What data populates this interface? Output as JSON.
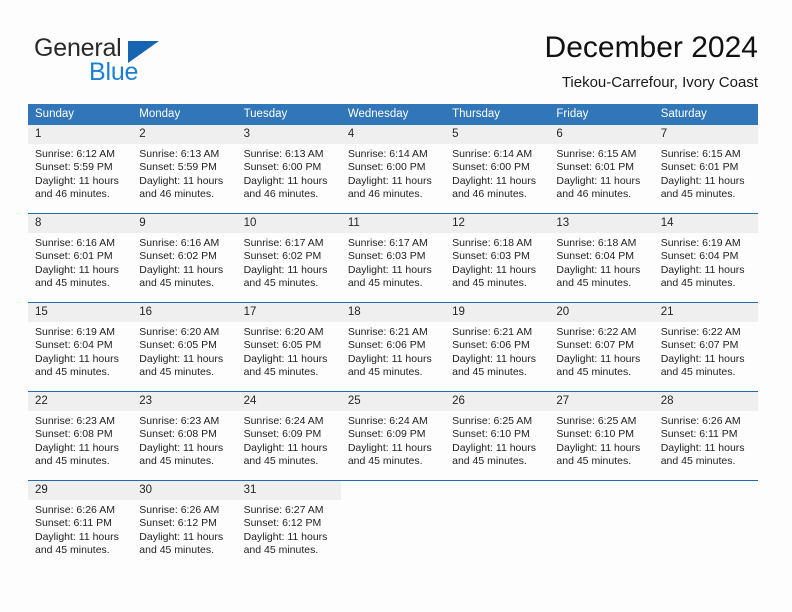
{
  "brand": {
    "name_line1": "General",
    "name_line2": "Blue",
    "triangle_color": "#1565b0",
    "blue_text_color": "#1b7fd4"
  },
  "header": {
    "title": "December 2024",
    "subtitle": "Tiekou-Carrefour, Ivory Coast"
  },
  "theme": {
    "header_bg": "#3176b9",
    "header_text": "#ffffff",
    "daynum_bg": "#efefef",
    "row_separator": "#1f6cb0",
    "page_bg": "#fdfdfd"
  },
  "weekdays": [
    "Sunday",
    "Monday",
    "Tuesday",
    "Wednesday",
    "Thursday",
    "Friday",
    "Saturday"
  ],
  "weeks": [
    [
      {
        "day": "1",
        "sunrise": "Sunrise: 6:12 AM",
        "sunset": "Sunset: 5:59 PM",
        "daylight1": "Daylight: 11 hours",
        "daylight2": "and 46 minutes."
      },
      {
        "day": "2",
        "sunrise": "Sunrise: 6:13 AM",
        "sunset": "Sunset: 5:59 PM",
        "daylight1": "Daylight: 11 hours",
        "daylight2": "and 46 minutes."
      },
      {
        "day": "3",
        "sunrise": "Sunrise: 6:13 AM",
        "sunset": "Sunset: 6:00 PM",
        "daylight1": "Daylight: 11 hours",
        "daylight2": "and 46 minutes."
      },
      {
        "day": "4",
        "sunrise": "Sunrise: 6:14 AM",
        "sunset": "Sunset: 6:00 PM",
        "daylight1": "Daylight: 11 hours",
        "daylight2": "and 46 minutes."
      },
      {
        "day": "5",
        "sunrise": "Sunrise: 6:14 AM",
        "sunset": "Sunset: 6:00 PM",
        "daylight1": "Daylight: 11 hours",
        "daylight2": "and 46 minutes."
      },
      {
        "day": "6",
        "sunrise": "Sunrise: 6:15 AM",
        "sunset": "Sunset: 6:01 PM",
        "daylight1": "Daylight: 11 hours",
        "daylight2": "and 46 minutes."
      },
      {
        "day": "7",
        "sunrise": "Sunrise: 6:15 AM",
        "sunset": "Sunset: 6:01 PM",
        "daylight1": "Daylight: 11 hours",
        "daylight2": "and 45 minutes."
      }
    ],
    [
      {
        "day": "8",
        "sunrise": "Sunrise: 6:16 AM",
        "sunset": "Sunset: 6:01 PM",
        "daylight1": "Daylight: 11 hours",
        "daylight2": "and 45 minutes."
      },
      {
        "day": "9",
        "sunrise": "Sunrise: 6:16 AM",
        "sunset": "Sunset: 6:02 PM",
        "daylight1": "Daylight: 11 hours",
        "daylight2": "and 45 minutes."
      },
      {
        "day": "10",
        "sunrise": "Sunrise: 6:17 AM",
        "sunset": "Sunset: 6:02 PM",
        "daylight1": "Daylight: 11 hours",
        "daylight2": "and 45 minutes."
      },
      {
        "day": "11",
        "sunrise": "Sunrise: 6:17 AM",
        "sunset": "Sunset: 6:03 PM",
        "daylight1": "Daylight: 11 hours",
        "daylight2": "and 45 minutes."
      },
      {
        "day": "12",
        "sunrise": "Sunrise: 6:18 AM",
        "sunset": "Sunset: 6:03 PM",
        "daylight1": "Daylight: 11 hours",
        "daylight2": "and 45 minutes."
      },
      {
        "day": "13",
        "sunrise": "Sunrise: 6:18 AM",
        "sunset": "Sunset: 6:04 PM",
        "daylight1": "Daylight: 11 hours",
        "daylight2": "and 45 minutes."
      },
      {
        "day": "14",
        "sunrise": "Sunrise: 6:19 AM",
        "sunset": "Sunset: 6:04 PM",
        "daylight1": "Daylight: 11 hours",
        "daylight2": "and 45 minutes."
      }
    ],
    [
      {
        "day": "15",
        "sunrise": "Sunrise: 6:19 AM",
        "sunset": "Sunset: 6:04 PM",
        "daylight1": "Daylight: 11 hours",
        "daylight2": "and 45 minutes."
      },
      {
        "day": "16",
        "sunrise": "Sunrise: 6:20 AM",
        "sunset": "Sunset: 6:05 PM",
        "daylight1": "Daylight: 11 hours",
        "daylight2": "and 45 minutes."
      },
      {
        "day": "17",
        "sunrise": "Sunrise: 6:20 AM",
        "sunset": "Sunset: 6:05 PM",
        "daylight1": "Daylight: 11 hours",
        "daylight2": "and 45 minutes."
      },
      {
        "day": "18",
        "sunrise": "Sunrise: 6:21 AM",
        "sunset": "Sunset: 6:06 PM",
        "daylight1": "Daylight: 11 hours",
        "daylight2": "and 45 minutes."
      },
      {
        "day": "19",
        "sunrise": "Sunrise: 6:21 AM",
        "sunset": "Sunset: 6:06 PM",
        "daylight1": "Daylight: 11 hours",
        "daylight2": "and 45 minutes."
      },
      {
        "day": "20",
        "sunrise": "Sunrise: 6:22 AM",
        "sunset": "Sunset: 6:07 PM",
        "daylight1": "Daylight: 11 hours",
        "daylight2": "and 45 minutes."
      },
      {
        "day": "21",
        "sunrise": "Sunrise: 6:22 AM",
        "sunset": "Sunset: 6:07 PM",
        "daylight1": "Daylight: 11 hours",
        "daylight2": "and 45 minutes."
      }
    ],
    [
      {
        "day": "22",
        "sunrise": "Sunrise: 6:23 AM",
        "sunset": "Sunset: 6:08 PM",
        "daylight1": "Daylight: 11 hours",
        "daylight2": "and 45 minutes."
      },
      {
        "day": "23",
        "sunrise": "Sunrise: 6:23 AM",
        "sunset": "Sunset: 6:08 PM",
        "daylight1": "Daylight: 11 hours",
        "daylight2": "and 45 minutes."
      },
      {
        "day": "24",
        "sunrise": "Sunrise: 6:24 AM",
        "sunset": "Sunset: 6:09 PM",
        "daylight1": "Daylight: 11 hours",
        "daylight2": "and 45 minutes."
      },
      {
        "day": "25",
        "sunrise": "Sunrise: 6:24 AM",
        "sunset": "Sunset: 6:09 PM",
        "daylight1": "Daylight: 11 hours",
        "daylight2": "and 45 minutes."
      },
      {
        "day": "26",
        "sunrise": "Sunrise: 6:25 AM",
        "sunset": "Sunset: 6:10 PM",
        "daylight1": "Daylight: 11 hours",
        "daylight2": "and 45 minutes."
      },
      {
        "day": "27",
        "sunrise": "Sunrise: 6:25 AM",
        "sunset": "Sunset: 6:10 PM",
        "daylight1": "Daylight: 11 hours",
        "daylight2": "and 45 minutes."
      },
      {
        "day": "28",
        "sunrise": "Sunrise: 6:26 AM",
        "sunset": "Sunset: 6:11 PM",
        "daylight1": "Daylight: 11 hours",
        "daylight2": "and 45 minutes."
      }
    ],
    [
      {
        "day": "29",
        "sunrise": "Sunrise: 6:26 AM",
        "sunset": "Sunset: 6:11 PM",
        "daylight1": "Daylight: 11 hours",
        "daylight2": "and 45 minutes."
      },
      {
        "day": "30",
        "sunrise": "Sunrise: 6:26 AM",
        "sunset": "Sunset: 6:12 PM",
        "daylight1": "Daylight: 11 hours",
        "daylight2": "and 45 minutes."
      },
      {
        "day": "31",
        "sunrise": "Sunrise: 6:27 AM",
        "sunset": "Sunset: 6:12 PM",
        "daylight1": "Daylight: 11 hours",
        "daylight2": "and 45 minutes."
      },
      {
        "day": "",
        "sunrise": "",
        "sunset": "",
        "daylight1": "",
        "daylight2": ""
      },
      {
        "day": "",
        "sunrise": "",
        "sunset": "",
        "daylight1": "",
        "daylight2": ""
      },
      {
        "day": "",
        "sunrise": "",
        "sunset": "",
        "daylight1": "",
        "daylight2": ""
      },
      {
        "day": "",
        "sunrise": "",
        "sunset": "",
        "daylight1": "",
        "daylight2": ""
      }
    ]
  ]
}
